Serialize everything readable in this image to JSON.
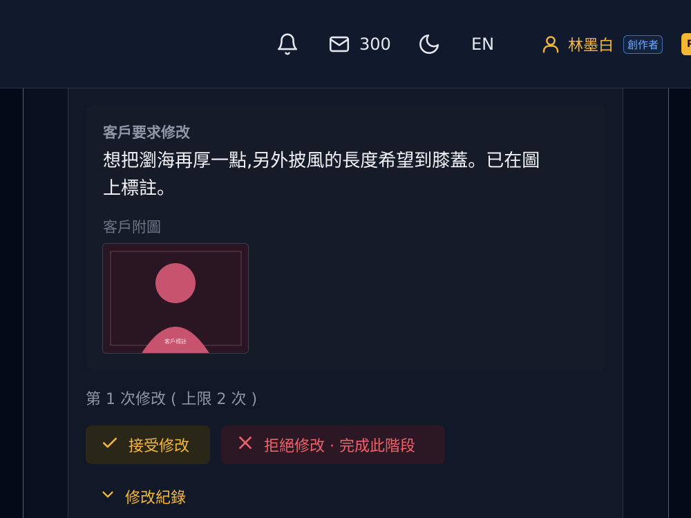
{
  "header": {
    "mail_count": "300",
    "language": "EN",
    "user_name": "林墨白",
    "role_badge": "創作者",
    "extra_badge": "P"
  },
  "request": {
    "title": "客戶要求修改",
    "body_line1": "想把瀏海再厚一點,另外披風的長度希望到膝蓋。已在圖",
    "body_line2": "上標註。",
    "attachment_label": "客戶附圖",
    "thumbnail_caption": "客戶標註"
  },
  "revision": {
    "count_text": "第 1 次修改 ( 上限 2 次 )"
  },
  "actions": {
    "accept_label": "接受修改",
    "reject_label": "拒絕修改 · 完成此階段"
  },
  "history": {
    "label": "修改紀錄"
  },
  "colors": {
    "accent": "#f5b733",
    "danger": "#f0616a",
    "badge_blue": "#6aa9ff",
    "thumb_circle": "#c8536f"
  },
  "icons": [
    "bell-icon",
    "mail-icon",
    "moon-icon",
    "user-icon",
    "check-icon",
    "x-icon",
    "chevron-down-icon"
  ]
}
